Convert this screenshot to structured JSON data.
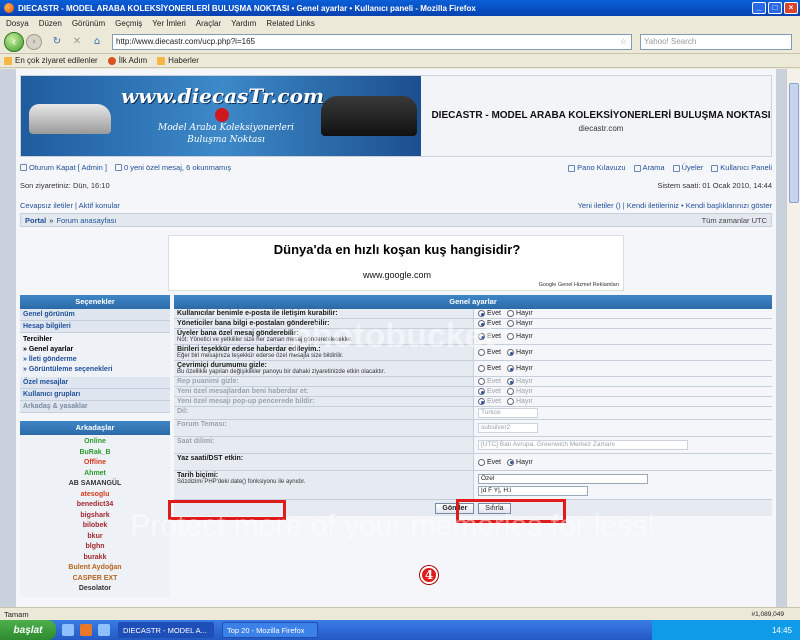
{
  "window": {
    "title": "DIECASTR - MODEL ARABA KOLEKSİYONERLERİ BULUŞMA NOKTASI • Genel ayarlar • Kullanıcı paneli - Mozilla Firefox"
  },
  "menu": [
    "Dosya",
    "Düzen",
    "Görünüm",
    "Geçmiş",
    "Yer İmleri",
    "Araçlar",
    "Yardım",
    "Related Links"
  ],
  "address": {
    "url": "http://www.diecastr.com/ucp.php?i=165",
    "search_placeholder": "Yahoo! Search"
  },
  "bookmarks": [
    "En çok ziyaret edilenler",
    "İlk Adım",
    "Haberler"
  ],
  "banner": {
    "logo": "www.diecasTr.com",
    "slogan_line1": "Model Araba Koleksiyonerleri",
    "slogan_line2": "Buluşma Noktası"
  },
  "site": {
    "title": "DIECASTR - MODEL ARABA KOLEKSİYONERLERİ BULUŞMA NOKTASI",
    "subtitle": "diecastr.com"
  },
  "userbar": {
    "logout": "Oturum Kapat [ Admin ]",
    "pm": "0 yeni özel mesaj, 6 okunmamış",
    "links": [
      "Pano Kılavuzu",
      "Arama",
      "Üyeler",
      "Kullanıcı Paneli"
    ]
  },
  "visit": {
    "last": "Son ziyaretiniz: Dün, 16:10",
    "system_time": "Sistem saati: 01 Ocak 2010, 14:44"
  },
  "quicklinks": {
    "left": "Cevapsız iletiler | Aktif konular",
    "right": "Yeni iletiler () | Kendi iletileriniz • Kendi başlıklarınızı göster"
  },
  "breadcrumb": {
    "portal": "Portal",
    "forum": "Forum anasayfası",
    "timezone": "Tüm zamanlar UTC"
  },
  "ad": {
    "question": "Dünya'da en hızlı koşan kuş hangisidir?",
    "url": "www.google.com",
    "google": "Google Genel Hizmet Reklamları"
  },
  "sidebar": {
    "header": "Seçenekler",
    "items_top": [
      "Genel görünüm",
      "Hesap bilgileri"
    ],
    "group": {
      "title": "Tercihler",
      "items": [
        "» Genel ayarlar",
        "» İleti gönderme",
        "» Görüntüleme seçenekleri"
      ]
    },
    "items_bottom": [
      "Özel mesajlar",
      "Kullanıcı grupları",
      "Arkadaş & yasaklar"
    ],
    "friends_header": "Arkadaşlar",
    "online_label": "Online",
    "offline_label": "Offline",
    "friends_online": [
      "BuRak_B"
    ],
    "friends_offline": [
      "Ahmet",
      "AB SAMANGÜL",
      "atesoglu",
      "benedict34",
      "bigshark",
      "bilobek",
      "bkur",
      "blghn",
      "burakk",
      "Bulent Aydoğan",
      "CASPER EXT",
      "Desolator"
    ]
  },
  "panel": {
    "header": "Genel ayarlar",
    "yes": "Evet",
    "no": "Hayır",
    "options": [
      {
        "label": "Kullanıcılar benimle e-posta ile iletişim kurabilir:",
        "hint": "",
        "yes": true
      },
      {
        "label": "Yöneticiler bana bilgi e-postaları gönderebilir:",
        "hint": "",
        "yes": true
      },
      {
        "label": "Üyeler bana özel mesaj gönderebilir:",
        "hint": "Not: Yönetici ve yetkililer size her zaman mesaj gönderebilecekler.",
        "yes": true
      },
      {
        "label": "Birileri teşekkür ederse haberdar edileyim.:",
        "hint": "Eğer biri mesajınıza teşekkür ederse özel mesajla size bildirilir.",
        "yes": false
      },
      {
        "label": "Çevrimiçi durumumu gizle:",
        "hint": "Bu özellikle yapılan değişiklikler panoyu bir dahaki ziyaretinizde etkin olacaktır.",
        "yes": false
      }
    ],
    "dim_options": [
      {
        "label": "Rep puanimi gizle:",
        "yes": false
      },
      {
        "label": "Yeni özel mesajlardan beni haberdar et:",
        "yes": true
      },
      {
        "label": "Yeni özel mesajı pop-up pencerede bildir:",
        "yes": true
      }
    ],
    "dil": {
      "label": "Dil:",
      "value": "Turkce"
    },
    "tema": {
      "label": "Forum Teması:",
      "value": "subsilver2"
    },
    "saat": {
      "label": "Saat dilimi:",
      "value": "[UTC] Batı Avrupa, Greenwich Merkez Zamanı"
    },
    "dst": {
      "label": "Yaz saati/DST etkin:",
      "yes": false
    },
    "tarih": {
      "label": "Tarih biçimi:",
      "hint": "Sözdizimi PHP'deki date() fonksiyonu ile aynıdır.",
      "select": "Özel",
      "value": "|d F Y|, H:i"
    },
    "submit": "Gönder",
    "reset": "Sıfırla"
  },
  "annotation": {
    "step_number": "4"
  },
  "watermark": {
    "line1": "photobucket",
    "line2": "Protect more of your memories for less!"
  },
  "status": {
    "text": "Tamam",
    "resolution": "#1,089,049"
  },
  "taskbar": {
    "start": "başlat",
    "tasks": [
      "DIECASTR - MODEL A...",
      "Top 20 - Mozilla Firefox"
    ],
    "time": "14:45"
  },
  "colors": {
    "highlight": "#e01b1b",
    "header_blue": "#2c6aa8",
    "online": "#2e9a2e",
    "offline": "#d43b1a"
  }
}
